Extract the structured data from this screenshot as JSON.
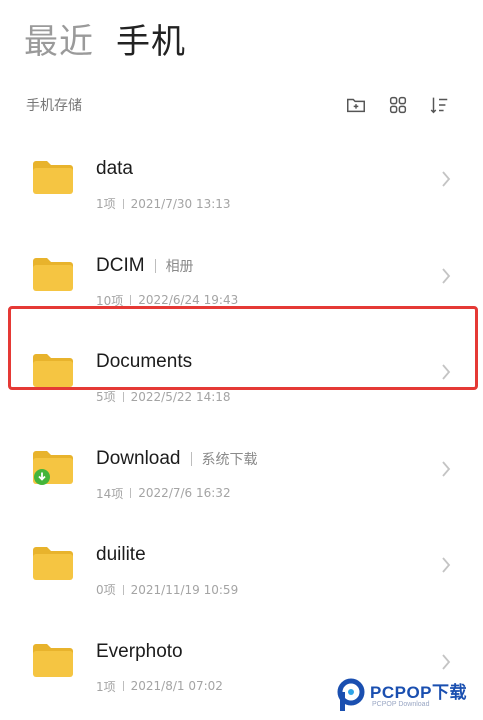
{
  "header": {
    "tabs": [
      {
        "label": "最近",
        "active": false
      },
      {
        "label": "手机",
        "active": true
      }
    ]
  },
  "subbar": {
    "storage_label": "手机存储",
    "icons": [
      "new-folder-icon",
      "grid-view-icon",
      "sort-icon"
    ]
  },
  "folders": [
    {
      "name": "data",
      "alias": "",
      "count": "1项",
      "date": "2021/7/30 13:13",
      "icon": "folder-icon"
    },
    {
      "name": "DCIM",
      "alias": "相册",
      "count": "10项",
      "date": "2022/6/24 19:43",
      "icon": "folder-icon"
    },
    {
      "name": "Documents",
      "alias": "",
      "count": "5项",
      "date": "2022/5/22 14:18",
      "icon": "folder-icon"
    },
    {
      "name": "Download",
      "alias": "系统下载",
      "count": "14项",
      "date": "2022/7/6 16:32",
      "icon": "download-folder-icon",
      "highlighted": true
    },
    {
      "name": "duilite",
      "alias": "",
      "count": "0项",
      "date": "2021/11/19 10:59",
      "icon": "folder-icon"
    },
    {
      "name": "Everphoto",
      "alias": "",
      "count": "1项",
      "date": "2021/8/1 07:02",
      "icon": "folder-icon"
    }
  ],
  "watermark": {
    "text": "PCPOP下载",
    "subtext": "PCPOP Download"
  },
  "colors": {
    "folder": "#f5c542",
    "folder_tab": "#e8b32c",
    "download_badge": "#43b53a",
    "highlight": "#e53935",
    "text_primary": "#1c1c1c",
    "text_secondary": "#a4a4a4"
  }
}
